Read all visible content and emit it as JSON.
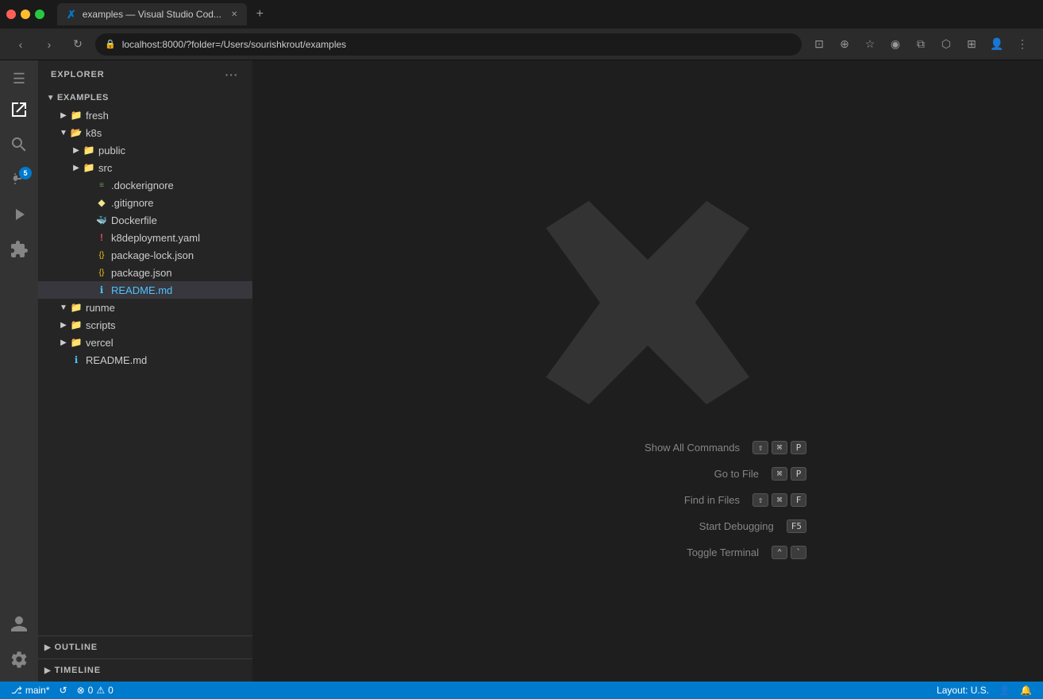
{
  "browser": {
    "tab_title": "examples — Visual Studio Cod...",
    "tab_icon": "✗",
    "address": "localhost:8000/?folder=/Users/sourishkrout/examples",
    "new_tab_label": "+"
  },
  "vscode": {
    "explorer_title": "EXPLORER",
    "explorer_more": "···",
    "root_folder": "EXAMPLES",
    "hamburger_icon": "☰",
    "tree_items": [
      {
        "id": "fresh",
        "label": "fresh",
        "type": "folder",
        "indent": 1,
        "collapsed": true,
        "arrow": "▶"
      },
      {
        "id": "k8s",
        "label": "k8s",
        "type": "folder",
        "indent": 1,
        "collapsed": false,
        "arrow": "▼"
      },
      {
        "id": "public",
        "label": "public",
        "type": "folder",
        "indent": 2,
        "collapsed": true,
        "arrow": "▶"
      },
      {
        "id": "src",
        "label": "src",
        "type": "folder",
        "indent": 2,
        "collapsed": true,
        "arrow": "▶"
      },
      {
        "id": "dockerignore",
        "label": ".dockerignore",
        "type": "file",
        "indent": 2,
        "icon_color": "#6b9955",
        "icon": "≡"
      },
      {
        "id": "gitignore",
        "label": ".gitignore",
        "type": "file",
        "indent": 2,
        "icon_color": "#f0e68c",
        "icon": "◆"
      },
      {
        "id": "dockerfile",
        "label": "Dockerfile",
        "type": "file",
        "indent": 2,
        "icon_color": "#1ba1e2",
        "icon": "🐳"
      },
      {
        "id": "k8deployment",
        "label": "k8deployment.yaml",
        "type": "file",
        "indent": 2,
        "icon_color": "#e44c4e",
        "icon": "!"
      },
      {
        "id": "pkglock",
        "label": "package-lock.json",
        "type": "file",
        "indent": 2,
        "icon_color": "#f1c40f",
        "icon": "{}"
      },
      {
        "id": "pkg",
        "label": "package.json",
        "type": "file",
        "indent": 2,
        "icon_color": "#f1c40f",
        "icon": "{}"
      },
      {
        "id": "readme_k8s",
        "label": "README.md",
        "type": "file",
        "indent": 2,
        "icon_color": "#4fc1ff",
        "icon": "ℹ",
        "active": true
      },
      {
        "id": "runme",
        "label": "runme",
        "type": "folder",
        "indent": 1,
        "collapsed": true,
        "arrow": "▼"
      },
      {
        "id": "scripts",
        "label": "scripts",
        "type": "folder",
        "indent": 1,
        "collapsed": true,
        "arrow": "▶"
      },
      {
        "id": "vercel",
        "label": "vercel",
        "type": "folder",
        "indent": 1,
        "collapsed": true,
        "arrow": "▶"
      },
      {
        "id": "readme_root",
        "label": "README.md",
        "type": "file",
        "indent": 1,
        "icon_color": "#4fc1ff",
        "icon": "ℹ"
      }
    ],
    "outline_label": "OUTLINE",
    "timeline_label": "TIMELINE",
    "commands": [
      {
        "label": "Show All Commands",
        "keys": [
          "⇧",
          "⌘",
          "P"
        ]
      },
      {
        "label": "Go to File",
        "keys": [
          "⌘",
          "P"
        ]
      },
      {
        "label": "Find in Files",
        "keys": [
          "⇧",
          "⌘",
          "F"
        ]
      },
      {
        "label": "Start Debugging",
        "keys": [
          "F5"
        ]
      },
      {
        "label": "Toggle Terminal",
        "keys": [
          "⌃",
          "`"
        ]
      }
    ],
    "status_bar": {
      "branch_icon": "⎇",
      "branch_name": "main*",
      "sync_icon": "↺",
      "error_icon": "⊗",
      "error_count": "0",
      "warning_icon": "⚠",
      "warning_count": "0",
      "layout_label": "Layout: U.S.",
      "notification_icon": "🔔"
    },
    "source_control_badge": "5"
  }
}
